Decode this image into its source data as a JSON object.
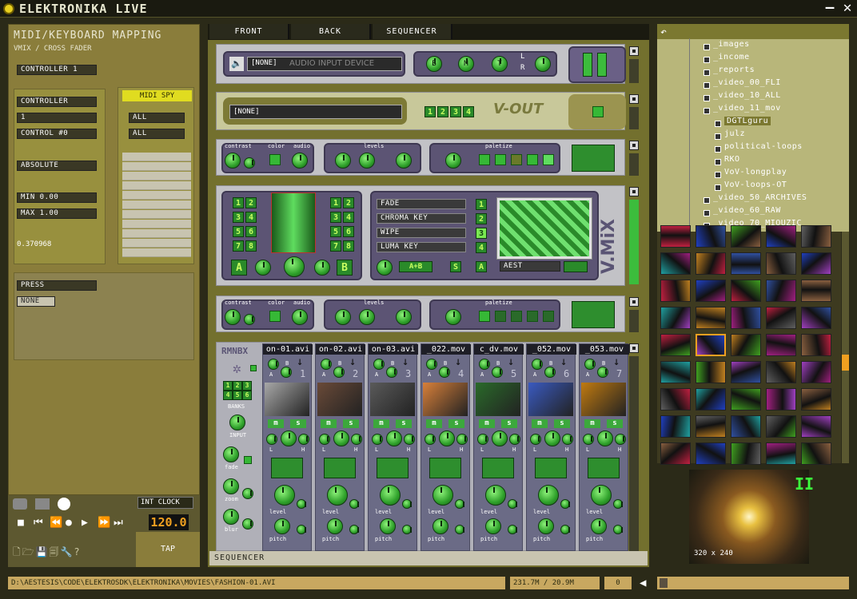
{
  "app": {
    "title": "ELEKTRONIKA LIVE"
  },
  "midi": {
    "title": "MIDI/KEYBOARD MAPPING",
    "subtitle": "VMIX / CROSS FADER",
    "controller_select": "CONTROLLER 1",
    "type": "CONTROLLER",
    "channel": "1",
    "control": "CONTROL #0",
    "mode": "ABSOLUTE",
    "min": "MIN 0.00",
    "max": "MAX 1.00",
    "value": "0.370968",
    "spy_label": "MIDI SPY",
    "spy_filter1": "ALL",
    "spy_filter2": "ALL",
    "key_action": "PRESS",
    "key_value": "NONE"
  },
  "transport": {
    "clock_label": "INT CLOCK",
    "bpm": "120.0",
    "tap": "TAP"
  },
  "tabs": [
    "FRONT",
    "BACK",
    "SEQUENCER"
  ],
  "audio_module": {
    "device": "[NONE]",
    "device_placeholder": "AUDIO INPUT DEVICE",
    "btn_b": "B",
    "btn_m": "M",
    "btn_t": "T",
    "lr_l": "L",
    "lr_r": "R"
  },
  "vout_module": {
    "device": "[NONE]",
    "logo": "V-OUT",
    "digits": [
      "1",
      "2",
      "3",
      "4"
    ]
  },
  "fx_module": {
    "contrast": "contrast",
    "color": "color",
    "audio": "audio",
    "levels": "levels",
    "paletize": "paletize"
  },
  "vmix": {
    "logo": "V.MiX",
    "modes": [
      "FADE",
      "CHROMA KEY",
      "WIPE",
      "LUMA KEY"
    ],
    "mode_numbers": [
      "1",
      "2",
      "3",
      "4"
    ],
    "wipe_name": "AEST",
    "left_nums": [
      "1",
      "2",
      "3",
      "4",
      "5",
      "6",
      "7",
      "8"
    ],
    "right_nums": [
      "1",
      "2",
      "3",
      "4",
      "5",
      "6",
      "7",
      "8"
    ],
    "btn_a": "A",
    "btn_b": "B",
    "btn_ab": "A+B",
    "btn_s": "S",
    "btn_a2": "A"
  },
  "rmnbx": {
    "title": "RMNBX",
    "banks_label": "BANKS",
    "bank_digits": [
      "1",
      "2",
      "3",
      "4",
      "5",
      "6"
    ],
    "input_label": "INPUT",
    "fade_label": "fade",
    "zoom_label": "zoom",
    "blur_label": "blur",
    "strip_labels": {
      "m": "m",
      "s": "s",
      "a": "A",
      "b": "B",
      "l": "L",
      "h": "H",
      "level": "level",
      "pitch": "pitch"
    },
    "channels": [
      {
        "name": "on-01.avi",
        "num": "1",
        "color": "#a8a8a8"
      },
      {
        "name": "on-02.avi",
        "num": "2",
        "color": "#6a4a38"
      },
      {
        "name": "on-03.avi",
        "num": "3",
        "color": "#5a5a5a"
      },
      {
        "name": "_022.mov",
        "num": "4",
        "color": "#d8803a"
      },
      {
        "name": "c_dv.mov",
        "num": "5",
        "color": "#2a6a2a"
      },
      {
        "name": "_052.mov",
        "num": "6",
        "color": "#3a5ac0"
      },
      {
        "name": "_053.mov",
        "num": "7",
        "color": "#c07a10"
      }
    ]
  },
  "sequencer_label": "SEQUENCER",
  "browser": {
    "items": [
      "_images",
      "_income",
      "_reports",
      "_video_00_FLI",
      "_video_10_ALL",
      "_video_11_mov",
      "DGTLguru",
      "julz",
      "political-loops",
      "RKO",
      "VoV-longplay",
      "VoV-loops-OT",
      "_video_50_ARCHIVES",
      "_video_60_RAW",
      "_video_70_MIOUZIC"
    ],
    "selected": "DGTLguru"
  },
  "preview": {
    "size": "320 x 240",
    "state": "II"
  },
  "status": {
    "path": "D:\\AESTESIS\\CODE\\ELEKTROSDK\\ELEKTRONIKA\\MOVIES\\FASHION-01.AVI",
    "memory": "231.7M / 20.9M",
    "count": "0"
  },
  "colors": {
    "accent": "#3cb83c",
    "panel": "#8a7d3b",
    "highlight": "#e0dc20"
  }
}
